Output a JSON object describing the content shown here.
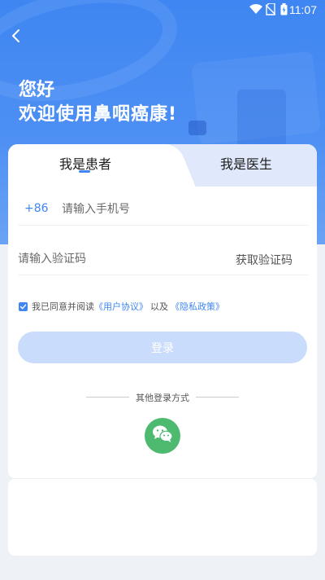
{
  "status_bar": {
    "time": "11:07"
  },
  "header": {
    "greeting_line1": "您好",
    "greeting_line2": "欢迎使用鼻咽癌康!"
  },
  "tabs": [
    {
      "label": "我是患者",
      "active": true
    },
    {
      "label": "我是医生",
      "active": false
    }
  ],
  "form": {
    "country_code": "+86",
    "phone_placeholder": "请输入手机号",
    "phone_value": "",
    "code_placeholder": "请输入验证码",
    "code_value": "",
    "get_code_label": "获取验证码"
  },
  "agreement": {
    "checked": true,
    "prefix": "我已同意并阅读",
    "user_agreement": "《用户协议》",
    "middle": "以及",
    "privacy_policy": "《隐私政策》"
  },
  "login_button": "登录",
  "other_login": {
    "label": "其他登录方式",
    "options": [
      "wechat-icon"
    ]
  },
  "colors": {
    "primary": "#3f86f2",
    "login_disabled": "#c9dcfb",
    "wechat": "#4dba6f"
  }
}
